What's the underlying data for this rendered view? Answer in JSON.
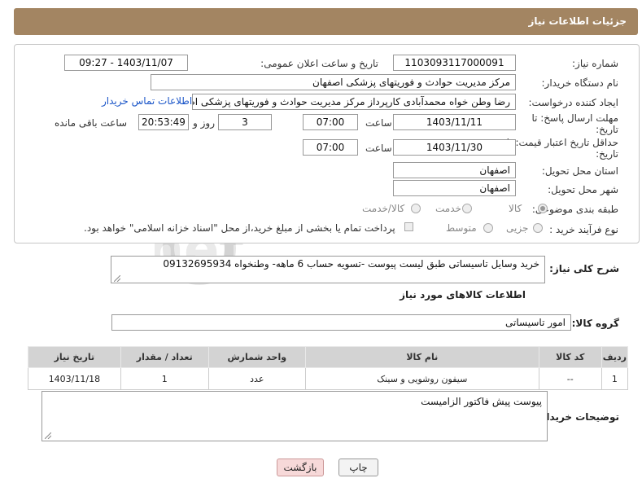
{
  "header": {
    "title": "جزئیات اطلاعات نیاز"
  },
  "form": {
    "need_number_label": "شماره نیاز:",
    "need_number": "1103093117000091",
    "announce_label": "تاریخ و ساعت اعلان عمومی:",
    "announce_value": "1403/11/07 - 09:27",
    "buyer_org_label": "نام دستگاه خریدار:",
    "buyer_org": "مرکز مدیریت حوادث و فوریتهای پزشکی اصفهان",
    "creator_label": "ایجاد کننده درخواست:",
    "creator": "رضا وطن خواه محمدآبادی کارپرداز مرکز مدیریت حوادث و فوریتهای پزشکی اصفها",
    "contact_link": "اطلاعات تماس خریدار",
    "reply_deadline_label_1": "مهلت ارسال پاسخ: تا",
    "reply_deadline_label_2": "تاریخ:",
    "reply_date": "1403/11/11",
    "time_label": "ساعت",
    "reply_time": "07:00",
    "days_value": "3",
    "days_label": "روز و",
    "remaining_time": "20:53:49",
    "remaining_label": "ساعت باقی مانده",
    "validity_label_1": "حداقل تاریخ اعتبار قیمت: تا",
    "validity_label_2": "تاریخ:",
    "validity_date": "1403/11/30",
    "validity_time_label": "ساعت",
    "validity_time": "07:00",
    "province_label": "استان محل تحویل:",
    "province": "اصفهان",
    "city_label": "شهر محل تحویل:",
    "city": "اصفهان",
    "category_label": "طبقه بندی موضوعی:",
    "category_options": [
      "کالا",
      "خدمت",
      "کالا/خدمت"
    ],
    "process_label": "نوع فرآیند خرید :",
    "process_options": [
      "جزیی",
      "متوسط"
    ],
    "payment_note": "پرداخت تمام یا بخشی از مبلغ خرید،از محل \"اسناد خزانه اسلامی\" خواهد بود."
  },
  "description": {
    "label": "شرح کلی نیاز:",
    "text": "خرید وسایل تاسیساتی طبق لیست پیوست -تسویه حساب 6 ماهه- وطنخواه 09132695934"
  },
  "goods": {
    "section_title": "اطلاعات کالاهای مورد نیاز",
    "group_label": "گروه کالا:",
    "group_value": "امور تاسیساتی",
    "columns": [
      "ردیف",
      "کد کالا",
      "نام کالا",
      "واحد شمارش",
      "تعداد / مقدار",
      "تاریخ نیاز"
    ],
    "rows": [
      {
        "row": "1",
        "code": "--",
        "name": "سیفون روشویی و سینک",
        "unit": "عدد",
        "qty": "1",
        "date": "1403/11/18"
      }
    ]
  },
  "buyer_notes": {
    "label": "توضیحات خریدار:",
    "text": "پیوست پیش فاکتور الزامیست"
  },
  "buttons": {
    "print": "چاپ",
    "back": "بازگشت"
  },
  "watermark": {
    "text": "AriaTender.net"
  },
  "colors": {
    "header_bg": "#a38562",
    "link": "#1a55c8",
    "back_button_bg": "#f7d9d9",
    "table_header_bg": "#d3d3d3"
  }
}
